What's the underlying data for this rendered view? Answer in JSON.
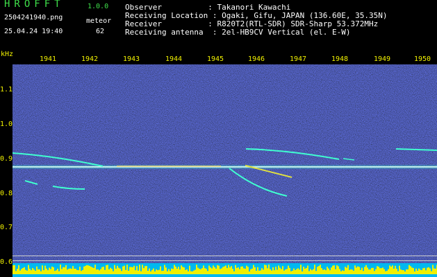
{
  "header": {
    "app_title": "HROFFT",
    "app_version": "1.0.0",
    "file_name": "2504241940.png",
    "mode_label": "meteor",
    "timestamp": "25.04.24 19:40",
    "meteor_count": "62"
  },
  "info": {
    "observer": "Observer          : Takanori Kawachi",
    "location": "Receiving Location : Ogaki, Gifu, JAPAN (136.60E, 35.35N)",
    "receiver": "Receiver          : R820T2(RTL-SDR) SDR-Sharp 53.372MHz",
    "antenna": "Receiving antenna  : 2el-HB9CV Vertical (el. E-W)"
  },
  "axes": {
    "y_unit": "kHz",
    "x_ticks": [
      "1941",
      "1942",
      "1943",
      "1944",
      "1945",
      "1946",
      "1947",
      "1948",
      "1949",
      "1950"
    ],
    "y_ticks": [
      "1.1",
      "1.0",
      "0.9",
      "0.8",
      "0.7",
      "0.6"
    ]
  },
  "colors": {
    "header_text": "#3fe04a",
    "label_text": "#f2f200",
    "background": "#000000",
    "noise_base": "#0a0a7a",
    "carrier": "#ffffff",
    "meteor_trail": "#40ffd0",
    "signal_bars": "#f0f000",
    "baseline": "#30d0ff"
  }
}
